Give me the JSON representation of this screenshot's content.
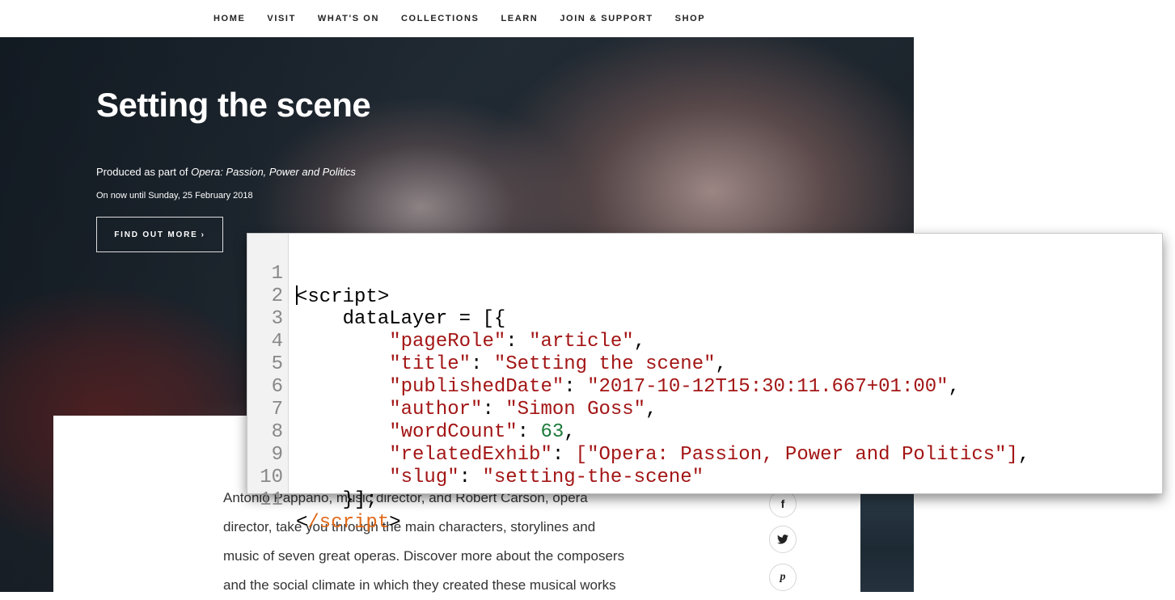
{
  "nav": [
    "HOME",
    "VISIT",
    "WHAT'S ON",
    "COLLECTIONS",
    "LEARN",
    "JOIN & SUPPORT",
    "SHOP"
  ],
  "hero": {
    "title": "Setting the scene",
    "produced_prefix": "Produced as part of ",
    "produced_exhibition": "Opera: Passion, Power and Politics",
    "dates": "On now until Sunday, 25 February 2018",
    "button_label": "FIND OUT MORE",
    "button_icon": "chevron-right-icon"
  },
  "article": {
    "lines": [
      "Antonio Pappano, music director, and Robert Carson, opera",
      "director, take you through the main characters, storylines and",
      "music of seven great operas. Discover more about the composers",
      "and the social climate in which they created these musical works"
    ]
  },
  "social": [
    {
      "icon": "facebook-icon",
      "glyph": "f"
    },
    {
      "icon": "twitter-icon",
      "glyph": "❖"
    },
    {
      "icon": "pinterest-icon",
      "glyph": "p"
    }
  ],
  "code": {
    "open_tag": "script",
    "close_tag": "/script",
    "var_line": "dataLayer = [{",
    "end_line": "}];",
    "entries": [
      {
        "key": "\"pageRole\"",
        "value": "\"article\"",
        "type": "string"
      },
      {
        "key": "\"title\"",
        "value": "\"Setting the scene\"",
        "type": "string"
      },
      {
        "key": "\"publishedDate\"",
        "value": "\"2017-10-12T15:30:11.667+01:00\"",
        "type": "string"
      },
      {
        "key": "\"author\"",
        "value": "\"Simon Goss\"",
        "type": "string"
      },
      {
        "key": "\"wordCount\"",
        "value": "63",
        "type": "number"
      },
      {
        "key": "\"relatedExhib\"",
        "value": "[\"Opera: Passion, Power and Politics\"]",
        "type": "array"
      },
      {
        "key": "\"slug\"",
        "value": "\"setting-the-scene\"",
        "type": "string"
      }
    ],
    "line_numbers": [
      "1",
      "2",
      "3",
      "4",
      "5",
      "6",
      "7",
      "8",
      "9",
      "10",
      "11"
    ]
  },
  "colors": {
    "code_string": "#a31515",
    "code_number": "#1d7a3a",
    "code_tag": "#e06a1a"
  }
}
